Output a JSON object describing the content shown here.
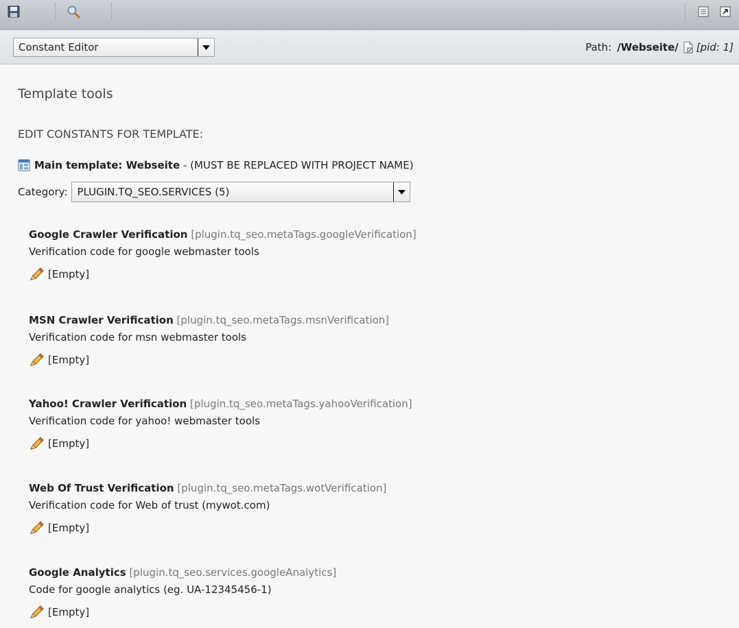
{
  "toolbar": {
    "left_icons": [
      "save-icon",
      "view-icon"
    ],
    "right_icons": [
      "clipboard-icon",
      "open-new-window-icon"
    ]
  },
  "docheader": {
    "function_menu": {
      "selected": "Constant Editor"
    },
    "path_label": "Path:",
    "path_value": "/Webseite/",
    "pid": "[pid: 1]"
  },
  "main": {
    "title": "Template tools",
    "section_heading": "EDIT CONSTANTS FOR TEMPLATE:",
    "template": {
      "title": "Main template: Webseite",
      "suffix": " - (MUST BE REPLACED WITH PROJECT NAME)"
    },
    "category": {
      "label": "Category:",
      "selected": "PLUGIN.TQ_SEO.SERVICES (5)"
    },
    "constants": [
      {
        "title": "Google Crawler Verification",
        "key": "[plugin.tq_seo.metaTags.googleVerification]",
        "description": "Verification code for google webmaster tools",
        "value": "[Empty]"
      },
      {
        "title": "MSN Crawler Verification",
        "key": "[plugin.tq_seo.metaTags.msnVerification]",
        "description": "Verification code for msn webmaster tools",
        "value": "[Empty]"
      },
      {
        "title": "Yahoo! Crawler Verification",
        "key": "[plugin.tq_seo.metaTags.yahooVerification]",
        "description": "Verification code for yahoo! webmaster tools",
        "value": "[Empty]"
      },
      {
        "title": "Web Of Trust Verification",
        "key": "[plugin.tq_seo.metaTags.wotVerification]",
        "description": "Verification code for Web of trust (mywot.com)",
        "value": "[Empty]"
      },
      {
        "title": "Google Analytics",
        "key": "[plugin.tq_seo.services.googleAnalytics]",
        "description": "Code for google analytics (eg. UA-12345456-1)",
        "value": "[Empty]"
      }
    ]
  }
}
